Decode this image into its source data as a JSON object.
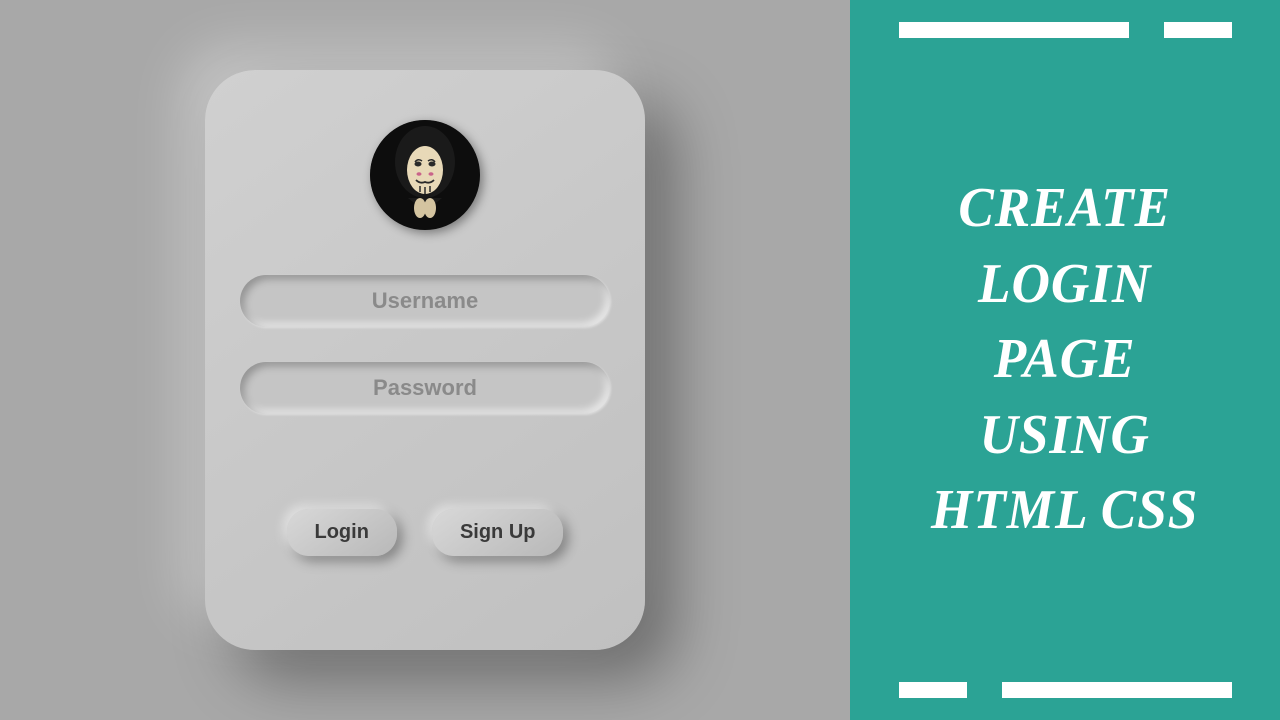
{
  "form": {
    "username_placeholder": "Username",
    "password_placeholder": "Password",
    "login_label": "Login",
    "signup_label": "Sign Up"
  },
  "headline": {
    "line1": "CREATE",
    "line2": "LOGIN",
    "line3": "PAGE",
    "line4": "USING",
    "line5": "HTML CSS"
  },
  "colors": {
    "accent": "#2ba395",
    "background": "#a8a8a8",
    "card": "#c8c8c8"
  }
}
